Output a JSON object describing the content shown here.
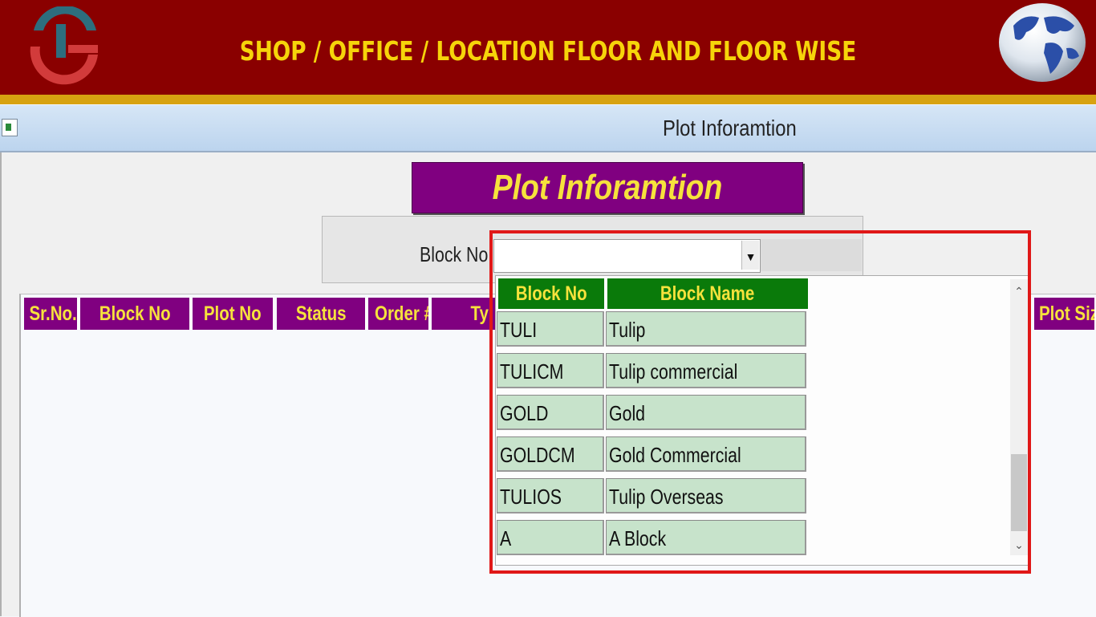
{
  "banner": {
    "title": "SHOP / OFFICE / LOCATION FLOOR AND FLOOR WISE",
    "logo_icon": "ts-logo-icon",
    "globe_icon": "globe-icon",
    "colors": {
      "background": "#8a0000",
      "stripe": "#d7a210",
      "title": "#f6d40a"
    }
  },
  "window": {
    "title": "Plot Inforamtion",
    "icon": "app-window-icon"
  },
  "form": {
    "heading": "Plot Inforamtion",
    "block_label": "Block No:",
    "block_value": "",
    "colors": {
      "heading_bg": "#800080",
      "heading_text": "#f6e23c"
    }
  },
  "grid": {
    "columns": [
      "Sr.No.",
      "Block No",
      "Plot No",
      "Status",
      "Order #",
      "Ty",
      "Plot Siz"
    ]
  },
  "dropdown": {
    "columns": [
      "Block No",
      "Block Name"
    ],
    "rows": [
      {
        "block_no": "TULI",
        "block_name": "Tulip"
      },
      {
        "block_no": "TULICM",
        "block_name": "Tulip commercial"
      },
      {
        "block_no": "GOLD",
        "block_name": "Gold"
      },
      {
        "block_no": "GOLDCM",
        "block_name": "Gold Commercial"
      },
      {
        "block_no": "TULIOS",
        "block_name": "Tulip Overseas"
      },
      {
        "block_no": "A",
        "block_name": "A Block"
      }
    ],
    "colors": {
      "header_bg": "#0a7a0a",
      "header_text": "#f6e23c",
      "row_bg": "#c7e3cb",
      "highlight": "#e01818"
    }
  }
}
